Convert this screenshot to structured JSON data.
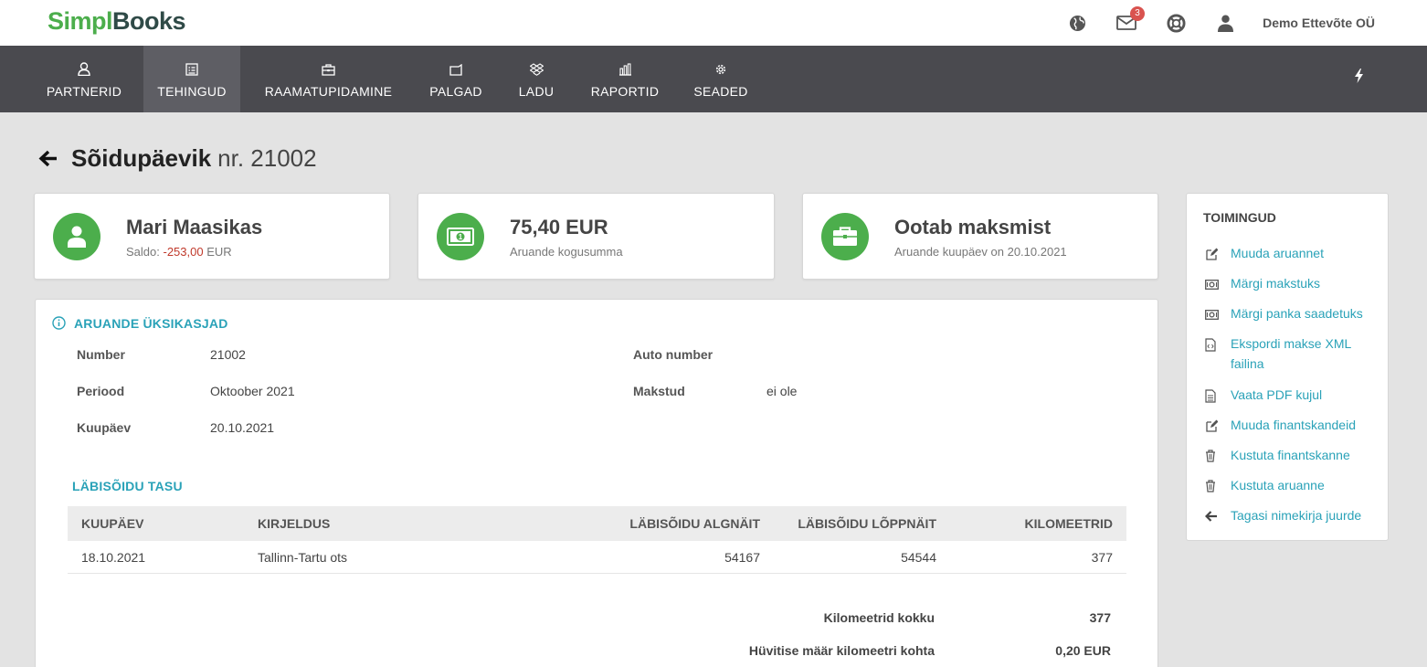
{
  "app": {
    "logo_part1": "Simpl",
    "logo_part2": "Books",
    "company": "Demo Ettevõte OÜ",
    "mail_count": "3"
  },
  "nav": {
    "items": [
      {
        "label": "PARTNERID",
        "icon": "user-icon"
      },
      {
        "label": "TEHINGUD",
        "icon": "transactions-icon",
        "active": true
      },
      {
        "label": "RAAMATUPIDAMINE",
        "icon": "briefcase-icon"
      },
      {
        "label": "PALGAD",
        "icon": "wallet-icon"
      },
      {
        "label": "LADU",
        "icon": "dropbox-icon"
      },
      {
        "label": "RAPORTID",
        "icon": "bar-chart-icon"
      },
      {
        "label": "SEADED",
        "icon": "gear-icon"
      }
    ]
  },
  "page": {
    "title": "Sõidupäevik",
    "number": "nr. 21002"
  },
  "cards": {
    "partner": {
      "name": "Mari Maasikas",
      "saldo_label": "Saldo: ",
      "saldo_value": "-253,00",
      "saldo_currency": " EUR"
    },
    "amount": {
      "value": "75,40 EUR",
      "sub": "Aruande kogusumma"
    },
    "status": {
      "value": "Ootab maksmist",
      "sub": "Aruande kuupäev on 20.10.2021"
    }
  },
  "details": {
    "heading": "ARUANDE ÜKSIKASJAD",
    "number_label": "Number",
    "number_value": "21002",
    "period_label": "Periood",
    "period_value": "Oktoober 2021",
    "date_label": "Kuupäev",
    "date_value": "20.10.2021",
    "car_label": "Auto number",
    "car_value": "",
    "paid_label": "Makstud",
    "paid_value": "ei ole"
  },
  "mileage": {
    "heading": "LÄBISÕIDU TASU",
    "columns": [
      "KUUPÄEV",
      "KIRJELDUS",
      "LÄBISÕIDU ALGNÄIT",
      "LÄBISÕIDU LÕPPNÄIT",
      "KILOMEETRID"
    ],
    "rows": [
      [
        "18.10.2021",
        "Tallinn-Tartu ots",
        "54167",
        "54544",
        "377"
      ]
    ],
    "total_km_label": "Kilomeetrid kokku",
    "total_km_value": "377",
    "rate_label": "Hüvitise määr kilomeetri kohta",
    "rate_value": "0,20 EUR"
  },
  "actions": {
    "heading": "TOIMINGUD",
    "items": [
      {
        "label": "Muuda aruannet",
        "icon": "edit-icon"
      },
      {
        "label": "Märgi makstuks",
        "icon": "money-icon"
      },
      {
        "label": "Märgi panka saadetuks",
        "icon": "money-icon"
      },
      {
        "label": "Ekspordi makse XML failina",
        "icon": "code-file-icon"
      },
      {
        "label": "Vaata PDF kujul",
        "icon": "file-icon"
      },
      {
        "label": "Muuda finantskandeid",
        "icon": "edit-icon"
      },
      {
        "label": "Kustuta finantskanne",
        "icon": "trash-icon"
      },
      {
        "label": "Kustuta aruanne",
        "icon": "trash-icon"
      },
      {
        "label": "Tagasi nimekirja juurde",
        "icon": "arrow-left-icon"
      }
    ]
  },
  "colors": {
    "accent": "#2aa2b8",
    "brand_green": "#4cae4c",
    "nav_bg": "#4a4a4f",
    "negative": "#c0392b"
  }
}
